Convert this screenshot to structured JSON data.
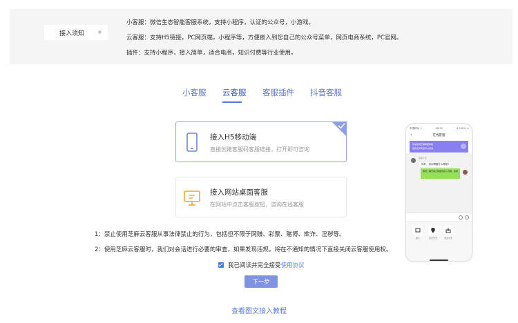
{
  "notice": {
    "tag_label": "接入须知",
    "lines": [
      "小客服：微信生态智能客服系统，支持小程序，认证的公众号，小游戏。",
      "云客服：支持H5链接，PC网页端，小程序等，方便嵌入到您自己的公众号菜单，网页电商系统，PC官网。",
      "插件：支持小程序，接入简单，适合电商，知识付费等行业使用。"
    ]
  },
  "tabs": [
    {
      "label": "小客服",
      "active": false
    },
    {
      "label": "云客服",
      "active": true
    },
    {
      "label": "客服插件",
      "active": false
    },
    {
      "label": "抖音客服",
      "active": false
    }
  ],
  "options": [
    {
      "title": "接入H5移动端",
      "desc": "直接创建客服码客服链接，打开即可咨询",
      "selected": true,
      "icon": "mobile-icon"
    },
    {
      "title": "接入网站桌面客服",
      "desc": "在网站中点击客服按钮，咨询在线客服",
      "selected": false,
      "icon": "desktop-icon"
    }
  ],
  "phone": {
    "status_left": "中国移动 ᯤ",
    "status_time": "08:20",
    "status_right": "◔ 100% ▭",
    "title": "在线客服",
    "banner_line1": "欢迎来到芝麻客服体验",
    "banner_line2": "您有任何问题可以咨询",
    "sender": "客服小芝",
    "bubble_left": "你好，请问需要什么帮助?",
    "bubble_right": "我想了解芝麻云客服的接入流程，谢谢",
    "tools": [
      "图片",
      "发送位置",
      "发送文件"
    ]
  },
  "rules": [
    "1：禁止使用芝麻云客服从事法律禁止的行为，包括但不限于网赚、彩票、赌博、欺诈、淫秽等。",
    "2：使用芝麻云客服时，我们对会话进行必要的审查，如果发现违规，将在不通知的情况下直接关闭云客服使用权。"
  ],
  "agreement": {
    "checked": true,
    "text": "我已阅读并完全接受",
    "link": "使用协议"
  },
  "next_button": "下一步",
  "tutorial_link": "查看图文接入教程",
  "colors": {
    "accent": "#5b74d6",
    "button": "#7f92e3",
    "link": "#4f86f0",
    "icon_desktop": "#f0a33a",
    "icon_mobile": "#6f84dd"
  }
}
